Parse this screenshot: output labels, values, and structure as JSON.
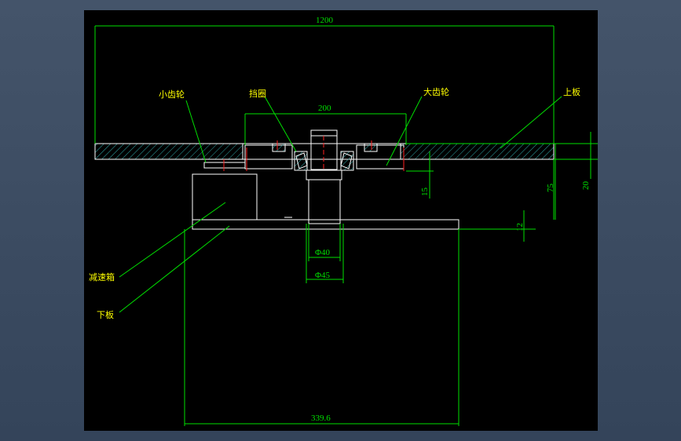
{
  "dimensions": {
    "top_length": "1200",
    "gear_span": "200",
    "d15": "15",
    "d75": "75",
    "d20": "20",
    "d12": "12",
    "phi40": "Φ40",
    "phi45": "Φ45",
    "base_width": "339.6"
  },
  "labels": {
    "small_gear": "小齿轮",
    "retaining_ring": "挡圈",
    "large_gear": "大齿轮",
    "upper_plate": "上板",
    "reducer": "减速箱",
    "lower_plate": "下板"
  },
  "colors": {
    "line": "#ffffff",
    "dim": "#00e000",
    "label": "#ffff00",
    "leader": "#00e000",
    "center": "#ff2020",
    "hatch": "#2fa8a8"
  }
}
